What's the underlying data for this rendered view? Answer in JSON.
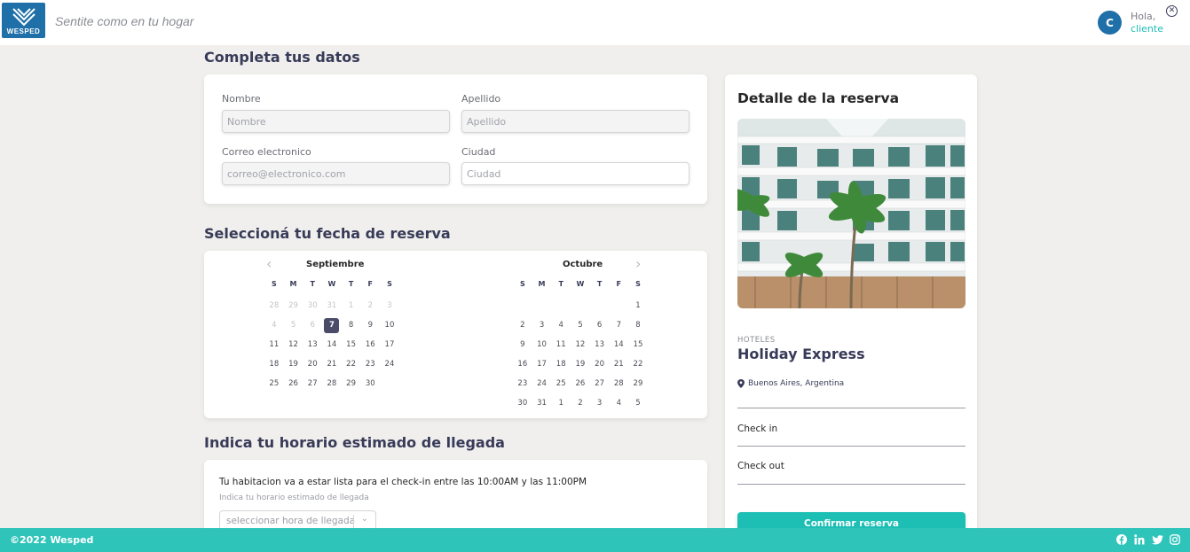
{
  "header": {
    "logo_text": "WESPED",
    "slogan": "Sentite como en tu hogar",
    "avatar_initial": "C",
    "greeting": "Hola,",
    "username": "cliente",
    "close_symbol": "✕"
  },
  "form": {
    "title": "Completa tus datos",
    "fields": [
      {
        "label": "Nombre",
        "placeholder": "Nombre"
      },
      {
        "label": "Apellido",
        "placeholder": "Apellido"
      },
      {
        "label": "Correo electronico",
        "placeholder": "correo@electronico.com"
      },
      {
        "label": "Ciudad",
        "placeholder": "Ciudad"
      }
    ]
  },
  "calendar": {
    "title": "Seleccioná tu fecha de reserva",
    "weekdays": [
      "S",
      "M",
      "T",
      "W",
      "T",
      "F",
      "S"
    ],
    "months": [
      {
        "name": "Septiembre",
        "days": [
          {
            "d": "28",
            "m": true
          },
          {
            "d": "29",
            "m": true
          },
          {
            "d": "30",
            "m": true
          },
          {
            "d": "31",
            "m": true
          },
          {
            "d": "1",
            "m": true
          },
          {
            "d": "2",
            "m": true
          },
          {
            "d": "3",
            "m": true
          },
          {
            "d": "4",
            "m": true
          },
          {
            "d": "5",
            "m": true
          },
          {
            "d": "6",
            "m": true
          },
          {
            "d": "7",
            "sel": true
          },
          {
            "d": "8"
          },
          {
            "d": "9"
          },
          {
            "d": "10"
          },
          {
            "d": "11"
          },
          {
            "d": "12"
          },
          {
            "d": "13"
          },
          {
            "d": "14"
          },
          {
            "d": "15"
          },
          {
            "d": "16"
          },
          {
            "d": "17"
          },
          {
            "d": "18"
          },
          {
            "d": "19"
          },
          {
            "d": "20"
          },
          {
            "d": "21"
          },
          {
            "d": "22"
          },
          {
            "d": "23"
          },
          {
            "d": "24"
          },
          {
            "d": "25"
          },
          {
            "d": "26"
          },
          {
            "d": "27"
          },
          {
            "d": "28"
          },
          {
            "d": "29"
          },
          {
            "d": "30"
          },
          {
            "d": ""
          }
        ]
      },
      {
        "name": "Octubre",
        "days": [
          {
            "d": ""
          },
          {
            "d": ""
          },
          {
            "d": ""
          },
          {
            "d": ""
          },
          {
            "d": ""
          },
          {
            "d": ""
          },
          {
            "d": "1"
          },
          {
            "d": "2"
          },
          {
            "d": "3"
          },
          {
            "d": "4"
          },
          {
            "d": "5"
          },
          {
            "d": "6"
          },
          {
            "d": "7"
          },
          {
            "d": "8"
          },
          {
            "d": "9"
          },
          {
            "d": "10"
          },
          {
            "d": "11"
          },
          {
            "d": "12"
          },
          {
            "d": "13"
          },
          {
            "d": "14"
          },
          {
            "d": "15"
          },
          {
            "d": "16"
          },
          {
            "d": "17"
          },
          {
            "d": "18"
          },
          {
            "d": "19"
          },
          {
            "d": "20"
          },
          {
            "d": "21"
          },
          {
            "d": "22"
          },
          {
            "d": "23"
          },
          {
            "d": "24"
          },
          {
            "d": "25"
          },
          {
            "d": "26"
          },
          {
            "d": "27"
          },
          {
            "d": "28"
          },
          {
            "d": "29"
          },
          {
            "d": "30"
          },
          {
            "d": "31"
          },
          {
            "d": "1"
          },
          {
            "d": "2"
          },
          {
            "d": "3"
          },
          {
            "d": "4"
          },
          {
            "d": "5"
          }
        ]
      }
    ],
    "prev_symbol": "‹",
    "next_symbol": "›"
  },
  "arrival": {
    "title": "Indica tu horario estimado de llegada",
    "message": "Tu habitacion va a estar lista para el check-in entre las 10:00AM y las 11:00PM",
    "hint": "Indica tu horario estimado de llegada",
    "select_placeholder": "seleccionar hora de llegada"
  },
  "detail": {
    "title": "Detalle de la reserva",
    "category": "HOTELES",
    "hotel_name": "Holiday Express",
    "location": "Buenos Aires, Argentina",
    "check_in_label": "Check in",
    "check_out_label": "Check out",
    "confirm_label": "Confirmar reserva"
  },
  "footer": {
    "copyright": "©2022 Wesped",
    "socials": [
      "facebook-icon",
      "linkedin-icon",
      "twitter-icon",
      "instagram-icon"
    ]
  },
  "colors": {
    "brand_blue": "#1f6fa8",
    "accent_teal": "#1dbeb4",
    "footer_teal": "#2fc4ba",
    "text_dark": "#383b58"
  }
}
